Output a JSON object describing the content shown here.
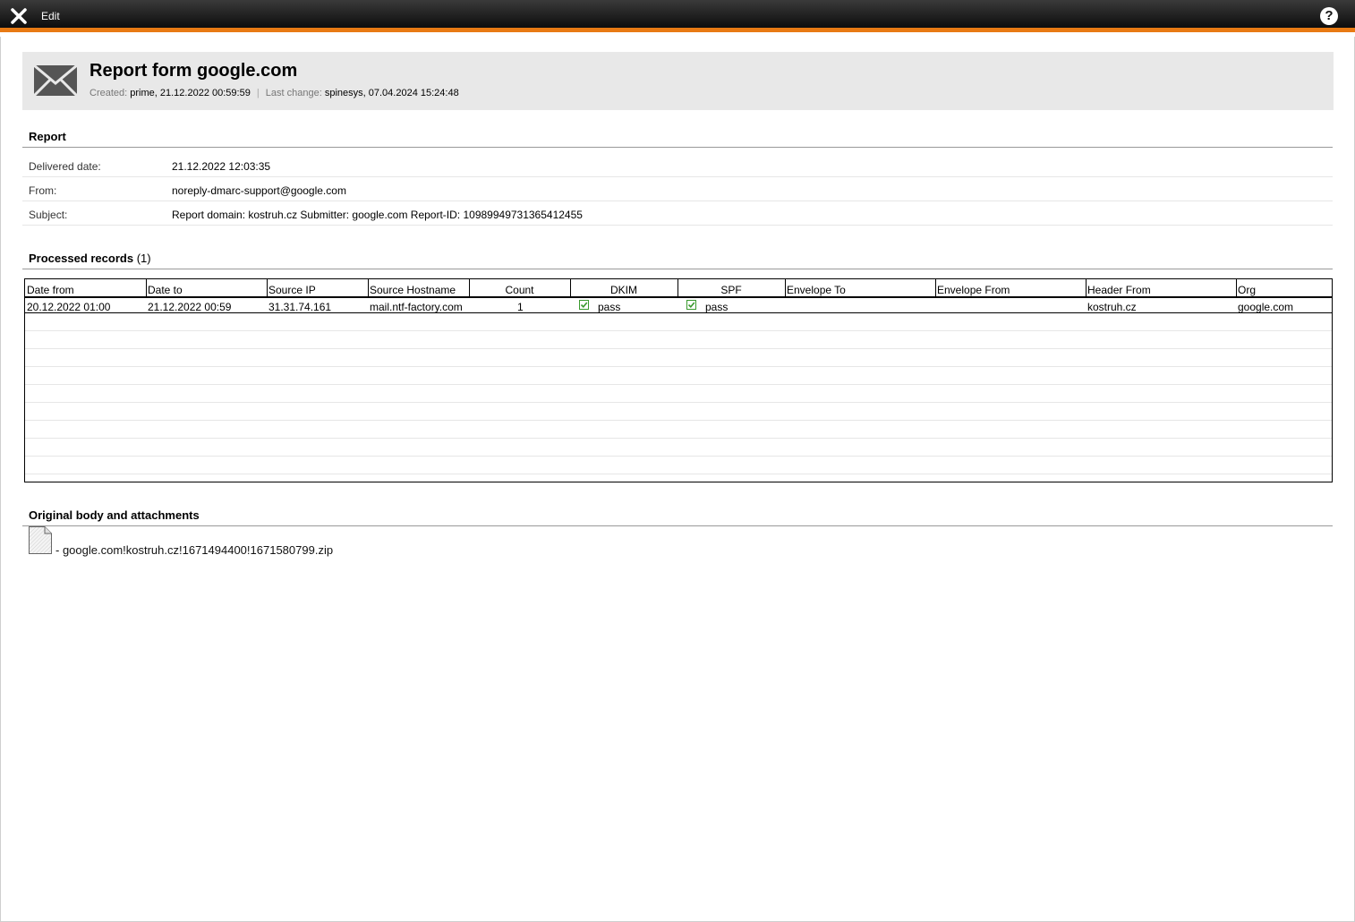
{
  "topbar": {
    "edit_label": "Edit",
    "help_label": "?"
  },
  "header": {
    "title": "Report form google.com",
    "created_label": "Created:",
    "created_value": "prime, 21.12.2022 00:59:59",
    "separator": "|",
    "changed_label": "Last change:",
    "changed_value": "spinesys, 07.04.2024 15:24:48"
  },
  "report": {
    "section_title": "Report",
    "fields": [
      {
        "label": "Delivered date:",
        "value": "21.12.2022 12:03:35"
      },
      {
        "label": "From:",
        "value": "noreply-dmarc-support@google.com"
      },
      {
        "label": "Subject:",
        "value": "Report domain: kostruh.cz Submitter: google.com Report-ID: 10989949731365412455"
      }
    ]
  },
  "records": {
    "section_title": "Processed records",
    "count": "(1)",
    "columns": [
      "Date from",
      "Date to",
      "Source IP",
      "Source Hostname",
      "Count",
      "DKIM",
      "SPF",
      "Envelope To",
      "Envelope From",
      "Header From",
      "Org"
    ],
    "rows": [
      {
        "date_from": "20.12.2022 01:00",
        "date_to": "21.12.2022 00:59",
        "source_ip": "31.31.74.161",
        "source_hostname": "mail.ntf-factory.com",
        "count": "1",
        "dkim": "pass",
        "spf": "pass",
        "envelope_to": "",
        "envelope_from": "",
        "header_from": "kostruh.cz",
        "org": "google.com"
      }
    ]
  },
  "attachments": {
    "section_title": "Original body and attachments",
    "file_name": "- google.com!kostruh.cz!1671494400!1671580799.zip"
  },
  "colors": {
    "accent": "#e87a14",
    "check": "#3a9a2e",
    "header_bg": "#e8e8e8"
  }
}
